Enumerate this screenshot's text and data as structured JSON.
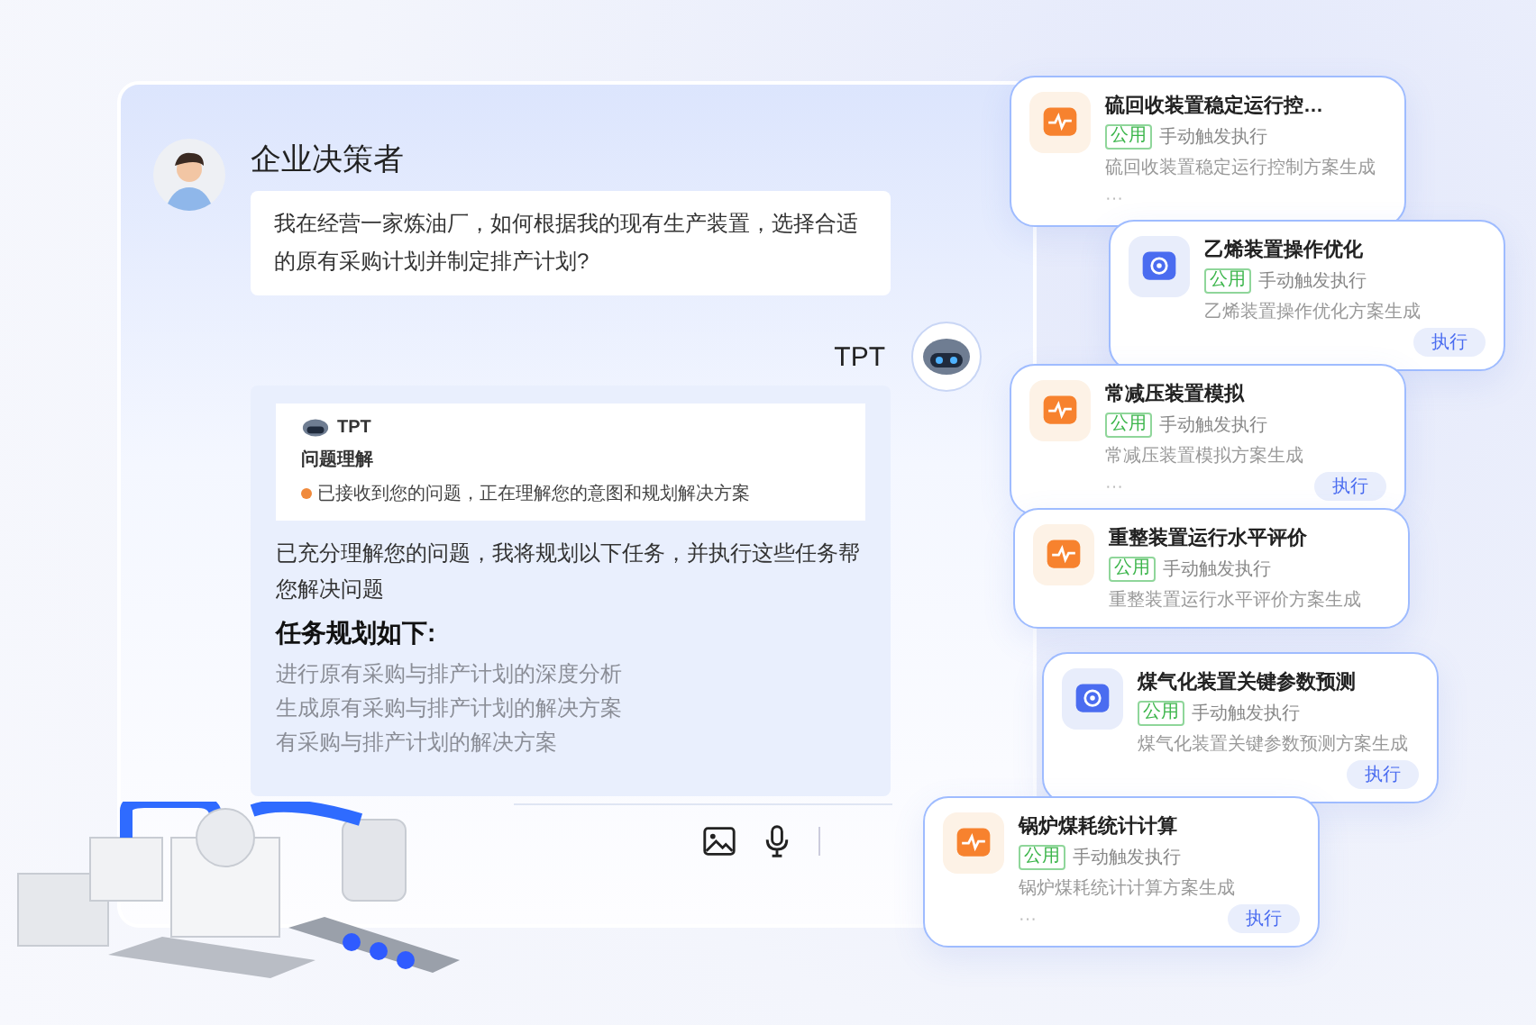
{
  "chat": {
    "user": {
      "name": "企业决策者",
      "message": "我在经营一家炼油厂，如何根据我的现有生产装置，选择合适的原有采购计划并制定排产计划?"
    },
    "bot": {
      "name": "TPT",
      "preview": {
        "name": "TPT",
        "heading": "问题理解",
        "status": "已接收到您的问题，正在理解您的意图和规划解决方案"
      },
      "intro": "已充分理解您的问题，我将规划以下任务，并执行这些任务帮您解决问题",
      "plan_title": "任务规划如下:",
      "plan": [
        "进行原有采购与排产计划的深度分析",
        "生成原有采购与排产计划的解决方案",
        "有采购与排产计划的解决方案"
      ]
    }
  },
  "agents": [
    {
      "kind": "pulse",
      "title": "硫回收装置稳定运行控…",
      "tag": "公用",
      "trigger": "手动触发执行",
      "description": "硫回收装置稳定运行控制方案生成",
      "more": "···"
    },
    {
      "kind": "hub",
      "title": "乙烯装置操作优化",
      "tag": "公用",
      "trigger": "手动触发执行",
      "description": "乙烯装置操作优化方案生成",
      "action": "执行"
    },
    {
      "kind": "pulse",
      "title": "常减压装置模拟",
      "tag": "公用",
      "trigger": "手动触发执行",
      "description": "常减压装置模拟方案生成",
      "more": "···",
      "action": "执行"
    },
    {
      "kind": "pulse",
      "title": "重整装置运行水平评价",
      "tag": "公用",
      "trigger": "手动触发执行",
      "description": "重整装置运行水平评价方案生成"
    },
    {
      "kind": "hub",
      "title": "煤气化装置关键参数预测",
      "tag": "公用",
      "trigger": "手动触发执行",
      "description": "煤气化装置关键参数预测方案生成",
      "action": "执行"
    },
    {
      "kind": "pulse",
      "title": "锅炉煤耗统计计算",
      "tag": "公用",
      "trigger": "手动触发执行",
      "description": "锅炉煤耗统计计算方案生成",
      "more": "···",
      "action": "执行"
    }
  ]
}
